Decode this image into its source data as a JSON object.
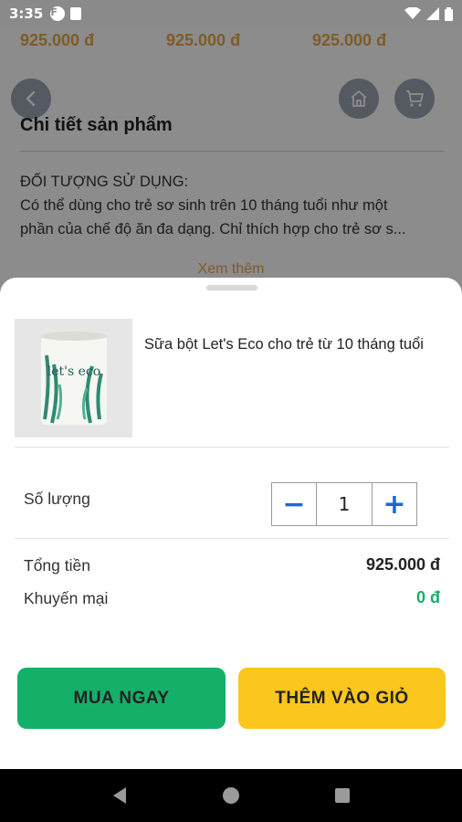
{
  "status_bar": {
    "time": "3:35"
  },
  "background": {
    "prices": [
      "925.000 đ",
      "925.000 đ",
      "925.000 đ"
    ],
    "section_title": "Chi tiết sản phẩm",
    "description_lines": [
      "ĐỐI TƯỢNG SỬ DỤNG:",
      "Có thể dùng cho trẻ sơ sinh trên 10 tháng tuổi như một",
      "phần của chế độ ăn đa dạng. Chỉ thích hợp cho trẻ sơ s..."
    ],
    "see_more": "Xem thêm",
    "icons": {
      "back": "back-arrow-icon",
      "home": "home-icon",
      "cart": "cart-icon"
    }
  },
  "sheet": {
    "product": {
      "name": "Sữa bột Let's Eco cho trẻ từ 10 tháng tuổi",
      "image_text": "let's eco"
    },
    "quantity_label": "Số lượng",
    "quantity": "1",
    "minus": "−",
    "plus": "+",
    "total_label": "Tổng tiền",
    "total_value": "925.000 đ",
    "promo_label": "Khuyến mại",
    "promo_value": "0 đ",
    "buy_now": "MUA NGAY",
    "add_to_cart": "THÊM VÀO GIỎ"
  },
  "colors": {
    "buy_button": "#14b06a",
    "cart_button": "#fbc71c",
    "price": "#e8a64a",
    "promo": "#14b06a",
    "stepper": "#1e66d6"
  }
}
